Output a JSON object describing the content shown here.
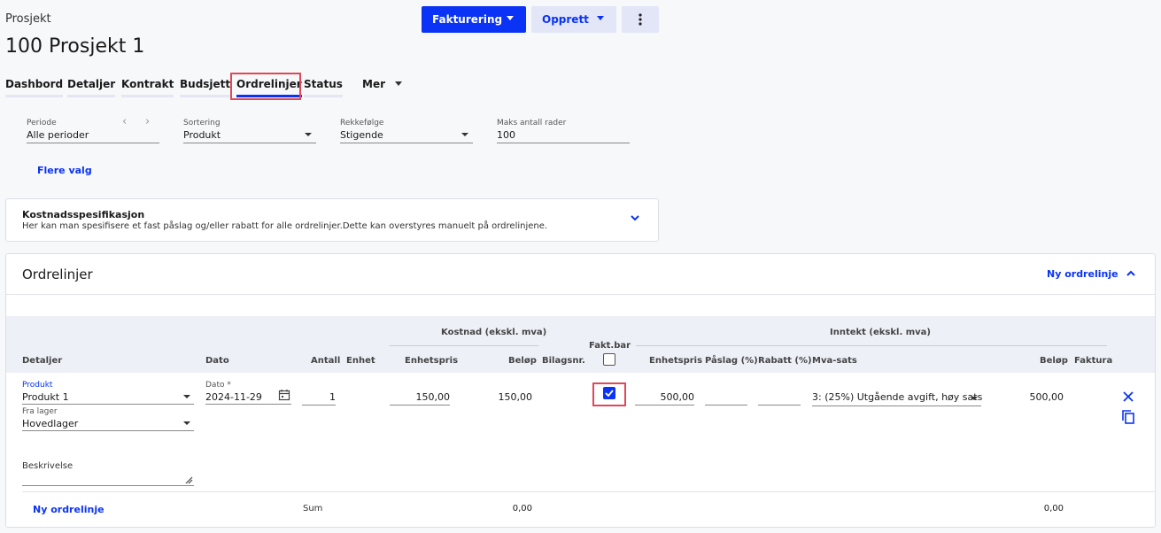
{
  "header": {
    "breadcrumb": "Prosjekt",
    "title": "100 Prosjekt 1",
    "primary_button": "Fakturering",
    "secondary_button": "Opprett"
  },
  "tabs": [
    "Dashbord",
    "Detaljer",
    "Kontrakt",
    "Budsjett",
    "Ordrelinjer",
    "Status",
    "Mer"
  ],
  "filters": {
    "period_label": "Periode",
    "period_value": "Alle perioder",
    "sort_label": "Sortering",
    "sort_value": "Produkt",
    "order_label": "Rekkefølge",
    "order_value": "Stigende",
    "max_label": "Maks antall rader",
    "max_value": "100",
    "more_options": "Flere valg"
  },
  "cost_spec": {
    "title": "Kostnadsspesifikasjon",
    "description": "Her kan man spesifisere et fast påslag og/eller rabatt for alle ordrelinjer.Dette kan overstyres manuelt på ordrelinjene."
  },
  "orderlines": {
    "title": "Ordrelinjer",
    "new_line": "Ny ordrelinje",
    "group_cost": "Kostnad (ekskl. mva)",
    "group_income": "Inntekt (ekskl. mva)",
    "fakt_bar": "Fakt.bar",
    "columns": {
      "details": "Detaljer",
      "date": "Dato",
      "quantity": "Antall",
      "unit": "Enhet",
      "cost_unit_price": "Enhetspris",
      "cost_amount": "Beløp",
      "voucher": "Bilagsnr.",
      "income_unit_price": "Enhetspris",
      "markup": "Påslag (%)",
      "discount": "Rabatt (%)",
      "vat": "Mva-sats",
      "income_amount": "Beløp",
      "invoice": "Faktura"
    },
    "row": {
      "product_label": "Produkt",
      "product_value": "Produkt 1",
      "warehouse_label": "Fra lager",
      "warehouse_value": "Hovedlager",
      "date_label": "Dato *",
      "date_value": "2024-11-29",
      "quantity": "1",
      "cost_unit_price": "150,00",
      "cost_amount": "150,00",
      "billable": true,
      "income_unit_price": "500,00",
      "vat": "3: (25%) Utgående avgift, høy sats",
      "income_amount": "500,00",
      "description_label": "Beskrivelse"
    },
    "footer": {
      "new_line": "Ny ordrelinje",
      "sum_label": "Sum",
      "cost_sum": "0,00",
      "income_sum": "0,00"
    }
  },
  "colors": {
    "accent": "#0a33f5",
    "highlight": "#e0485a"
  }
}
